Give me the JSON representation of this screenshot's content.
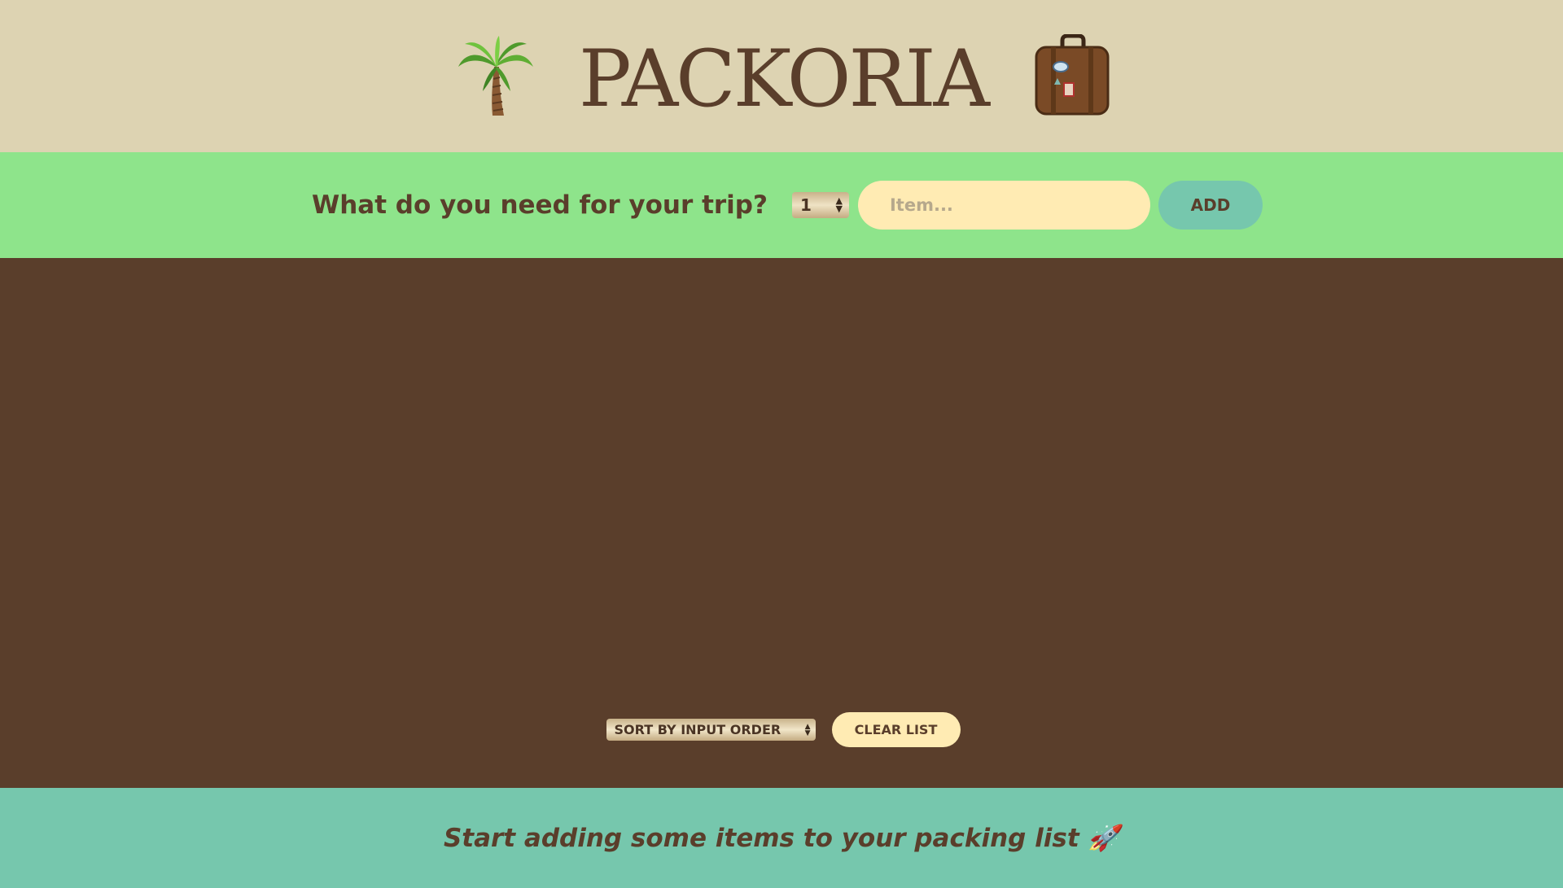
{
  "header": {
    "title": "PACKORIA",
    "left_icon": "palm-tree-icon",
    "right_icon": "suitcase-icon"
  },
  "form": {
    "question": "What do you need for your trip?",
    "quantity_value": "1",
    "item_placeholder": "Item...",
    "add_label": "ADD"
  },
  "list": {
    "items": [],
    "sort_value": "SORT BY INPUT ORDER",
    "clear_label": "CLEAR LIST"
  },
  "stats": {
    "message": "Start adding some items to your packing list 🚀"
  },
  "colors": {
    "header_bg": "#ddd3b2",
    "form_bg": "#8ee48b",
    "list_bg": "#5a3e2b",
    "stats_bg": "#76c7ad",
    "input_bg": "#ffebb3",
    "text_brown": "#5a3e2b"
  }
}
